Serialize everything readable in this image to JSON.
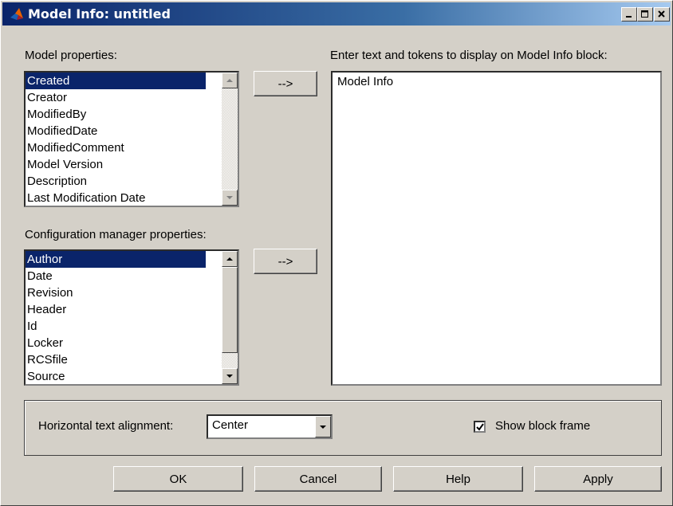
{
  "window": {
    "title": "Model Info: untitled"
  },
  "model_properties": {
    "label": "Model properties:",
    "items": [
      "Created",
      "Creator",
      "ModifiedBy",
      "ModifiedDate",
      "ModifiedComment",
      "Model Version",
      "Description",
      "Last Modification Date"
    ],
    "selected": "Created"
  },
  "config_properties": {
    "label": "Configuration manager properties:",
    "items": [
      "Author",
      "Date",
      "Revision",
      "Header",
      "Id",
      "Locker",
      "RCSfile",
      "Source"
    ],
    "selected": "Author"
  },
  "arrow_button_label": "-->",
  "text_area": {
    "label": "Enter text and tokens to display on Model Info block:",
    "content": "Model Info"
  },
  "alignment": {
    "label": "Horizontal text alignment:",
    "value": "Center"
  },
  "show_frame": {
    "label": "Show block frame",
    "checked": true
  },
  "buttons": {
    "ok": "OK",
    "cancel": "Cancel",
    "help": "Help",
    "apply": "Apply"
  }
}
